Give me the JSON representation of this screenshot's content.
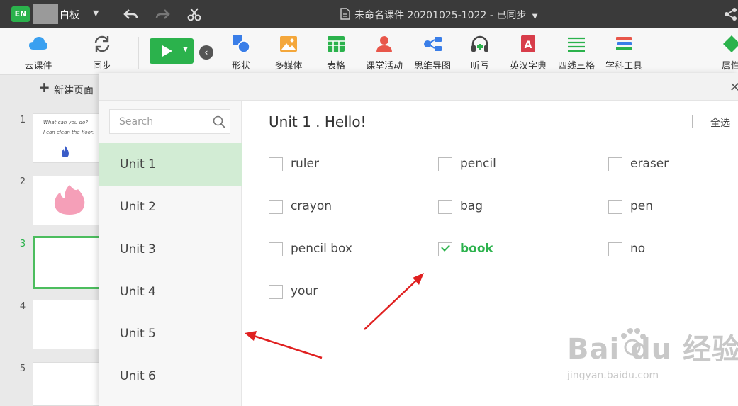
{
  "titlebar": {
    "logo_text": "EN",
    "app_name": "白板",
    "document_title": "未命名课件 20201025-1022 - 已同步"
  },
  "toolbar": {
    "cloud": "云课件",
    "sync": "同步",
    "shape": "形状",
    "media": "多媒体",
    "table": "表格",
    "activity": "课堂活动",
    "mindmap": "思维导图",
    "dictation": "听写",
    "dictionary": "英汉字典",
    "four_line": "四线三格",
    "subject_tools": "学科工具",
    "properties": "属性"
  },
  "slides": {
    "new_page": "新建页面",
    "items": [
      {
        "number": "1",
        "line1": "What can you do?",
        "line2": "I can clean the floor."
      },
      {
        "number": "2"
      },
      {
        "number": "3"
      },
      {
        "number": "4"
      },
      {
        "number": "5"
      }
    ]
  },
  "dialog": {
    "search_placeholder": "Search",
    "units": [
      "Unit 1",
      "Unit 2",
      "Unit 3",
      "Unit 4",
      "Unit 5",
      "Unit 6"
    ],
    "active_unit": "Unit 1",
    "title": "Unit 1 . Hello!",
    "select_all": "全选",
    "words": [
      {
        "text": "ruler",
        "checked": false
      },
      {
        "text": "pencil",
        "checked": false
      },
      {
        "text": "eraser",
        "checked": false
      },
      {
        "text": "crayon",
        "checked": false
      },
      {
        "text": "bag",
        "checked": false
      },
      {
        "text": "pen",
        "checked": false
      },
      {
        "text": "pencil box",
        "checked": false
      },
      {
        "text": "book",
        "checked": true
      },
      {
        "text": "no",
        "checked": false
      },
      {
        "text": "your",
        "checked": false
      }
    ]
  },
  "watermark": {
    "brand": "Bai du 经验",
    "url": "jingyan.baidu.com"
  },
  "colors": {
    "accent_green": "#2bb24c",
    "active_unit_bg": "#d2ecd4",
    "annotation_red": "#e02020"
  }
}
